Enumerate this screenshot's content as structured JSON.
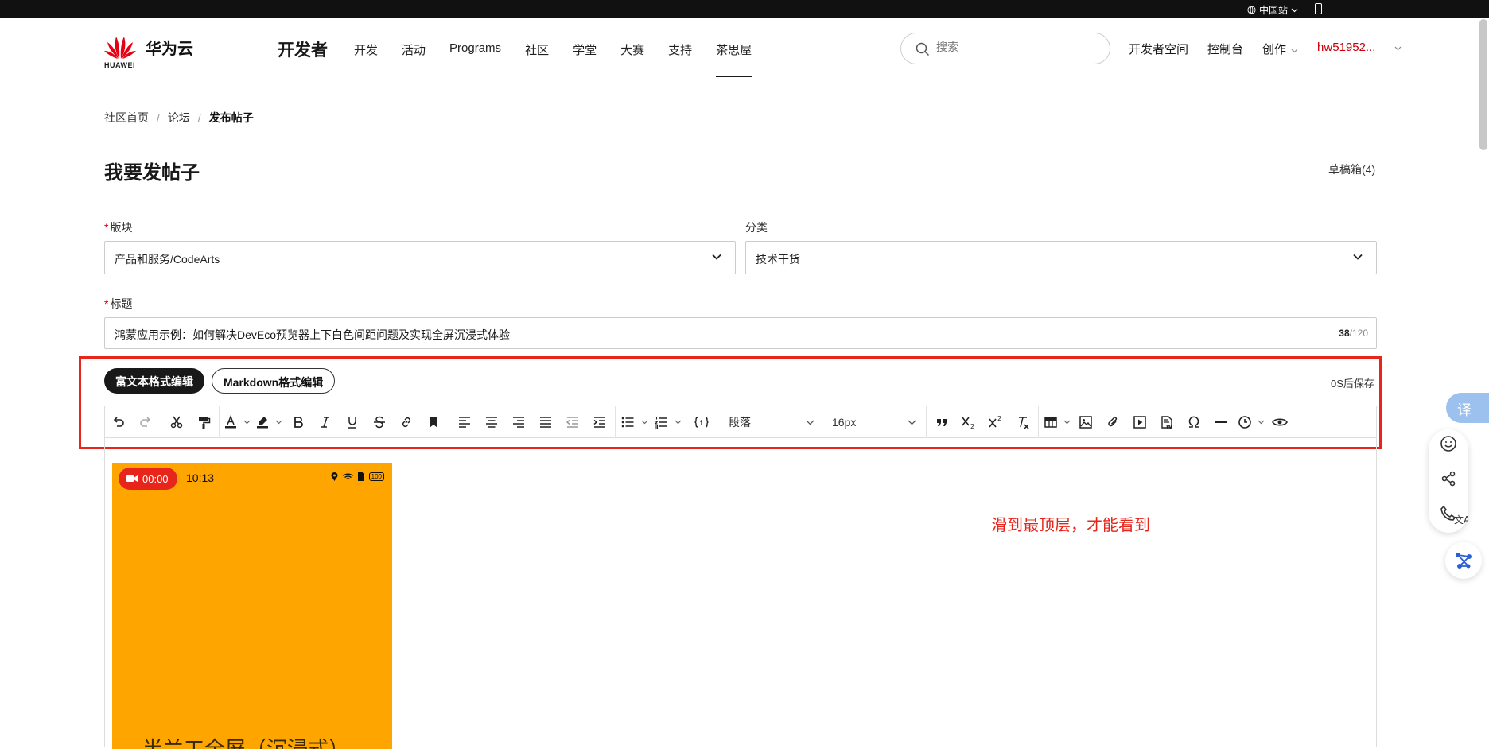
{
  "topbar": {
    "region": "中国站"
  },
  "header": {
    "brand": "华为云",
    "brand_sub": "HUAWEI",
    "developer": "开发者",
    "nav": [
      "开发",
      "活动",
      "Programs",
      "社区",
      "学堂",
      "大赛",
      "支持",
      "茶思屋"
    ],
    "active_nav": "茶思屋",
    "search_placeholder": "搜索",
    "links": {
      "space": "开发者空间",
      "console": "控制台",
      "create": "创作",
      "user": "hw51952..."
    }
  },
  "breadcrumb": [
    "社区首页",
    "论坛",
    "发布帖子"
  ],
  "page_title": "我要发帖子",
  "drafts": "草稿箱(4)",
  "form": {
    "section_label": "版块",
    "section_value": "产品和服务/CodeArts",
    "category_label": "分类",
    "category_value": "技术干货",
    "title_label": "标题",
    "title_value": "鸿蒙应用示例：如何解决DevEco预览器上下白色间距问题及实现全屏沉浸式体验",
    "title_count": "38",
    "title_max": "/120"
  },
  "editor": {
    "mode_richtext": "富文本格式编辑",
    "mode_markdown": "Markdown格式编辑",
    "autosave": "0S后保存",
    "paragraph": "段落",
    "font_size": "16px"
  },
  "content": {
    "rec_time": "00:00",
    "clock": "10:13",
    "battery": "100",
    "bigtext": "半兰工全屏（沉浸式）",
    "note": "滑到最顶层，才能看到"
  },
  "float": {
    "translate": "译"
  },
  "colors": {
    "accent_red": "#c7000b",
    "annotation_red": "#e8251a",
    "phone_bg": "#ffa500"
  }
}
